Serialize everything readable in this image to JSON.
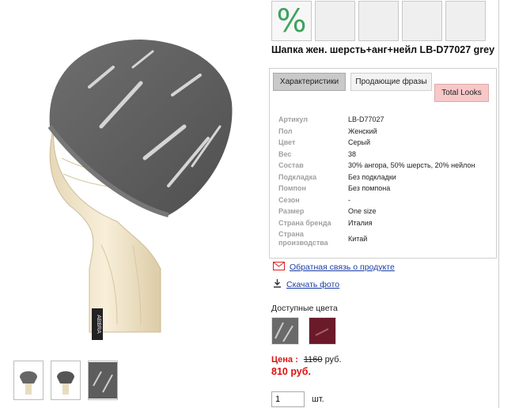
{
  "product": {
    "title": "Шапка жен. шерсть+анг+нейл LB-D77027 grey",
    "brand_mark": "ABBRA"
  },
  "swatches": {
    "discount_symbol": "%"
  },
  "tabs": [
    {
      "label": "Характеристики"
    },
    {
      "label": "Продающие фразы"
    },
    {
      "label": "Total Looks"
    }
  ],
  "specs": [
    {
      "label": "Артикул",
      "value": "LB-D77027"
    },
    {
      "label": "Пол",
      "value": "Женский"
    },
    {
      "label": "Цвет",
      "value": "Серый"
    },
    {
      "label": "Вес",
      "value": "38"
    },
    {
      "label": "Состав",
      "value": "30% ангора, 50% шерсть, 20% нейлон"
    },
    {
      "label": "Подкладка",
      "value": "Без подкладки"
    },
    {
      "label": "Помпон",
      "value": "Без помпона"
    },
    {
      "label": "Сезон",
      "value": "-"
    },
    {
      "label": "Размер",
      "value": "One size"
    },
    {
      "label": "Страна бренда",
      "value": "Италия"
    },
    {
      "label": "Страна производства",
      "value": "Китай"
    }
  ],
  "links": {
    "feedback": "Обратная связь о продукте",
    "download_photo": "Скачать фото"
  },
  "colors": {
    "label": "Доступные цвета",
    "options": [
      {
        "name": "grey",
        "hex": "#6a6a6a"
      },
      {
        "name": "burgundy",
        "hex": "#6b1a2a"
      }
    ]
  },
  "price": {
    "label": "Цена :",
    "old": "1160",
    "currency": "руб.",
    "new": "810 руб."
  },
  "quantity": {
    "value": "1",
    "unit": "шт."
  },
  "icons": {
    "feedback": "envelope-icon",
    "download": "download-icon"
  }
}
